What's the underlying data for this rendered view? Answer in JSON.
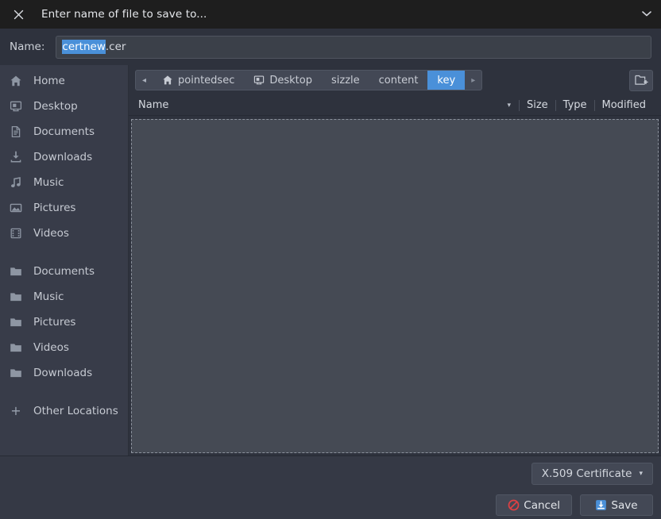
{
  "titlebar": {
    "title": "Enter name of file to save to...",
    "close_icon": "close-icon",
    "menu_icon": "chevron-down-icon"
  },
  "name_row": {
    "label": "Name:",
    "value_selected": "certnew",
    "value_rest": ".cer",
    "full_value": "certnew.cer",
    "selection_color": "#4a90d9"
  },
  "sidebar": {
    "places": [
      {
        "label": "Home",
        "icon": "home-icon"
      },
      {
        "label": "Desktop",
        "icon": "desktop-icon"
      },
      {
        "label": "Documents",
        "icon": "document-icon"
      },
      {
        "label": "Downloads",
        "icon": "download-icon"
      },
      {
        "label": "Music",
        "icon": "music-note-icon"
      },
      {
        "label": "Pictures",
        "icon": "picture-icon"
      },
      {
        "label": "Videos",
        "icon": "film-icon"
      }
    ],
    "folders": [
      {
        "label": "Documents",
        "icon": "folder-icon"
      },
      {
        "label": "Music",
        "icon": "folder-icon"
      },
      {
        "label": "Pictures",
        "icon": "folder-icon"
      },
      {
        "label": "Videos",
        "icon": "folder-icon"
      },
      {
        "label": "Downloads",
        "icon": "folder-icon"
      }
    ],
    "other_locations": {
      "label": "Other Locations",
      "icon": "plus-icon"
    }
  },
  "pathbar": {
    "back_arrow": "◂",
    "forward_arrow": "▸",
    "crumbs": [
      {
        "label": "pointedsec",
        "icon": "home-icon",
        "active": false
      },
      {
        "label": "Desktop",
        "icon": "desktop-icon",
        "active": false
      },
      {
        "label": "sizzle",
        "icon": "",
        "active": false
      },
      {
        "label": "content",
        "icon": "",
        "active": false
      },
      {
        "label": "key",
        "icon": "",
        "active": true
      }
    ],
    "new_folder_icon": "new-folder-icon",
    "active_color": "#4a90d9"
  },
  "columns": {
    "name": "Name",
    "sort_indicator": "▾",
    "size": "Size",
    "type": "Type",
    "modified": "Modified"
  },
  "filelist": {
    "rows": []
  },
  "bottom": {
    "filter": {
      "label": "X.509 Certificate",
      "chevron": "▾"
    },
    "cancel": {
      "label": "Cancel",
      "icon": "prohibited-icon",
      "icon_color": "#e04043"
    },
    "save": {
      "label": "Save",
      "icon": "save-download-icon",
      "icon_color": "#4a90d9"
    }
  }
}
